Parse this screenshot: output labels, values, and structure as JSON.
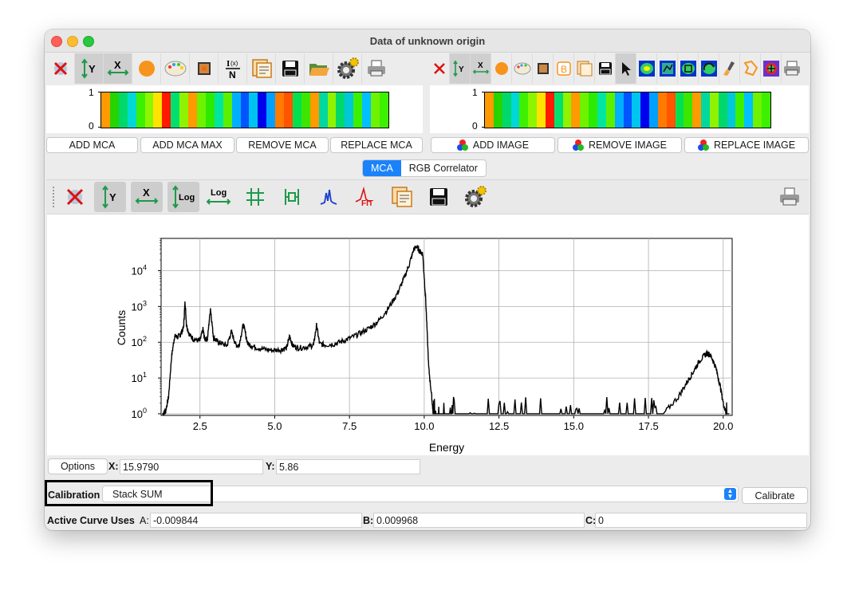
{
  "window": {
    "title": "Data of unknown origin"
  },
  "top_left_toolbar": {
    "icons": [
      "reset-zoom-icon",
      "y-autoscale-icon",
      "x-autoscale-icon",
      "orange-circle-icon",
      "palette-icon",
      "image-icon",
      "normalize-icon",
      "clipboard-icon",
      "save-icon",
      "open-folder-icon",
      "gear-icon",
      "printer-icon"
    ]
  },
  "top_right_toolbar": {
    "icons": [
      "reset-zoom-icon",
      "y-autoscale-icon",
      "x-autoscale-icon",
      "orange-circle-icon",
      "palette-icon",
      "image-icon",
      "b-icon",
      "clipboard-icon",
      "save-icon",
      "pointer-icon",
      "colormap-icon",
      "colormap-2-icon",
      "colormap-3-icon",
      "colormap-4-icon",
      "brush-icon",
      "polygon-icon",
      "target-icon",
      "printer-icon"
    ]
  },
  "strip_left": {
    "y_max": "1",
    "y_min": "0"
  },
  "strip_right": {
    "y_max": "1",
    "y_min": "0"
  },
  "mca_buttons": {
    "add_mca": "ADD MCA",
    "add_mca_max": "ADD MCA MAX",
    "remove_mca": "REMOVE MCA",
    "replace_mca": "REPLACE MCA"
  },
  "image_buttons": {
    "add_image": "ADD IMAGE",
    "remove_image": "REMOVE IMAGE",
    "replace_image": "REPLACE IMAGE"
  },
  "tabs": {
    "mca": "MCA",
    "rgb": "RGB Correlator"
  },
  "chart_data": {
    "type": "line",
    "xlabel": "Energy",
    "ylabel": "Counts",
    "yscale": "log",
    "xlim": [
      1.2,
      20.3
    ],
    "ylim": [
      0.9,
      80000
    ],
    "xticks": [
      "2.5",
      "5.0",
      "7.5",
      "10.0",
      "12.5",
      "15.0",
      "17.5",
      "20.0"
    ],
    "yticks": [
      "10",
      "10",
      "10",
      "10",
      "10"
    ],
    "ytick_exponents": [
      "0",
      "1",
      "2",
      "3",
      "4"
    ],
    "grid": true,
    "series": [
      {
        "x": [
          1.25,
          1.35,
          1.45,
          1.55,
          1.65,
          1.75,
          1.85,
          1.95,
          2.0,
          2.05,
          2.15,
          2.3,
          2.5,
          2.6,
          2.65,
          2.75,
          2.85,
          2.95,
          3.05,
          3.2,
          3.4,
          3.55,
          3.7,
          3.8,
          3.95,
          4.1,
          4.3,
          4.6,
          4.9,
          5.2,
          5.4,
          5.5,
          5.6,
          5.8,
          6.1,
          6.3,
          6.4,
          6.5,
          6.7,
          7.0,
          7.3,
          7.6,
          7.9,
          8.2,
          8.5,
          8.8,
          9.1,
          9.3,
          9.5,
          9.65,
          9.75,
          9.85,
          9.95,
          10.05,
          10.15,
          10.25,
          10.3,
          10.4,
          10.5,
          10.7,
          11.0,
          11.5,
          12.0,
          12.5,
          13.0,
          13.5,
          14.0,
          14.5,
          15.0,
          15.5,
          16.0,
          16.5,
          17.0,
          17.5,
          18.0,
          18.5,
          18.8,
          19.0,
          19.2,
          19.4,
          19.5,
          19.6,
          19.75,
          19.9,
          20.0,
          20.1,
          20.2
        ],
        "y": [
          1,
          1.2,
          3,
          40,
          150,
          140,
          170,
          250,
          1400,
          300,
          160,
          120,
          110,
          230,
          130,
          120,
          900,
          140,
          110,
          95,
          80,
          200,
          85,
          80,
          320,
          90,
          75,
          65,
          60,
          62,
          70,
          150,
          80,
          70,
          75,
          85,
          300,
          90,
          85,
          90,
          110,
          140,
          190,
          260,
          420,
          900,
          2300,
          5500,
          15000,
          40000,
          48000,
          35000,
          30000,
          1500,
          20,
          3,
          1,
          1,
          1,
          1,
          1,
          1,
          1,
          1,
          1,
          1,
          1,
          1,
          1,
          1,
          1,
          1,
          1,
          1,
          1,
          3,
          8,
          15,
          30,
          45,
          50,
          40,
          20,
          6,
          2,
          1,
          1
        ],
        "color": "#000000"
      }
    ]
  },
  "readout": {
    "options_label": "Options",
    "x_label": "X:",
    "x_value": "15.9790",
    "y_label": "Y:",
    "y_value": "5.86"
  },
  "calibration": {
    "label": "Calibration",
    "selected": "Stack SUM",
    "calibrate_button": "Calibrate"
  },
  "active_curve": {
    "label": "Active Curve Uses",
    "a_label": "A:",
    "a_value": "-0.009844",
    "b_label": "B:",
    "b_value": "0.009968",
    "c_label": "C:",
    "c_value": "0"
  },
  "colors": {
    "accent": "#1a82fb",
    "highlight_border": "#000000"
  }
}
